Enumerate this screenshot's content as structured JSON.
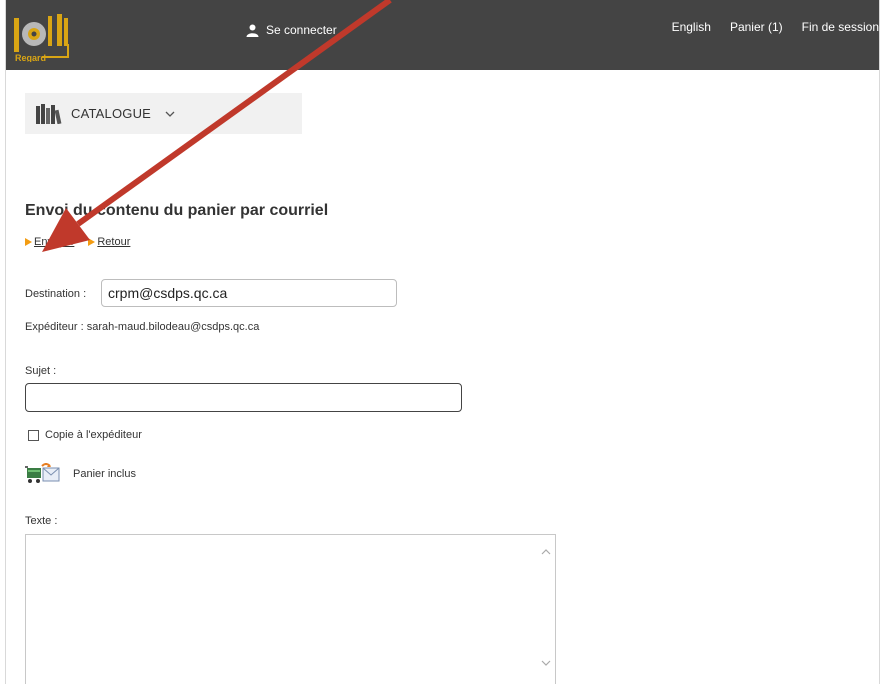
{
  "header": {
    "logo_text": "Regard",
    "login_label": "Se connecter",
    "nav": [
      "English",
      "Panier (1)",
      "Fin de session"
    ]
  },
  "catalogue": {
    "label": "CATALOGUE"
  },
  "page": {
    "title": "Envoi du contenu du panier par courriel",
    "actions": {
      "send": "Envoyer",
      "back": "Retour"
    }
  },
  "form": {
    "destination_label": "Destination :",
    "destination_value": "crpm@csdps.qc.ca",
    "sender_text": "Expéditeur : sarah-maud.bilodeau@csdps.qc.ca",
    "subject_label": "Sujet :",
    "subject_value": "",
    "copy_label": "Copie à l'expéditeur",
    "copy_checked": false,
    "cart_label": "Panier inclus",
    "text_label": "Texte :",
    "text_value": ""
  },
  "colors": {
    "topbar": "#444444",
    "accent_orange": "#f39c12",
    "logo_gold": "#d9a514",
    "annotation_arrow": "#c0392b"
  },
  "icons": [
    "logo-icon",
    "user-icon",
    "books-icon",
    "chevron-down-icon",
    "triangle-right-icon",
    "cart-mail-icon",
    "scroll-up-icon",
    "scroll-down-icon",
    "annotation-arrow"
  ]
}
